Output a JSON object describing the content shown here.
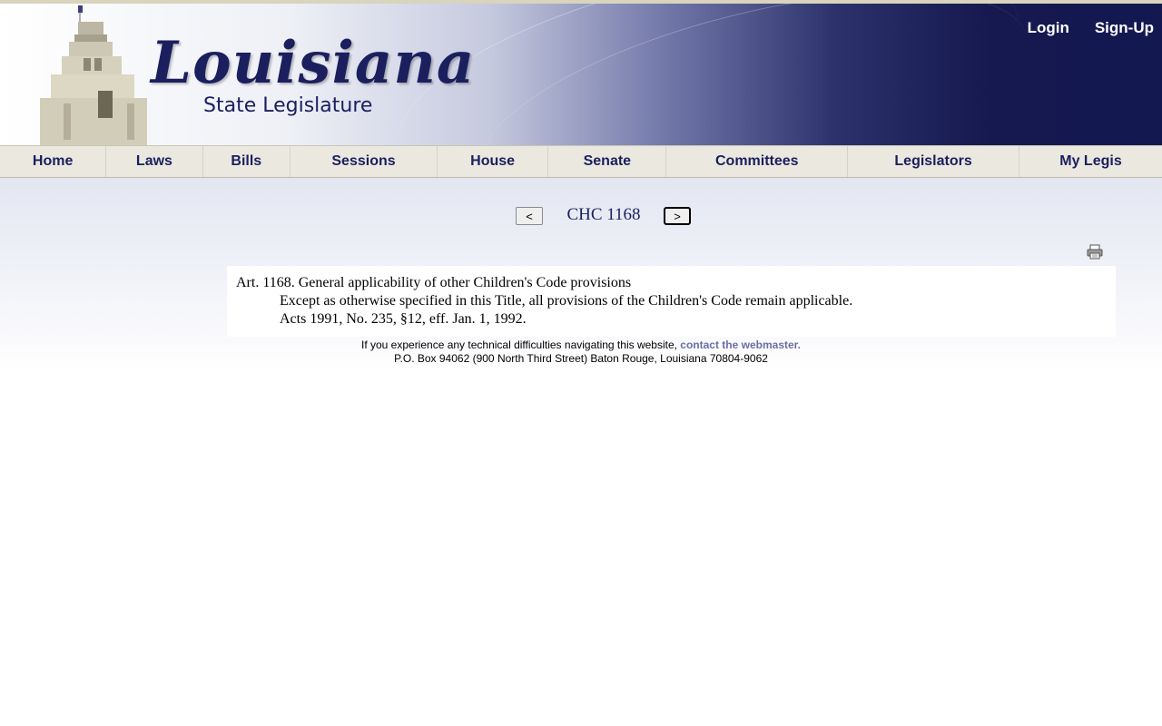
{
  "header": {
    "logo_title": "Louisiana",
    "logo_subtitle": "State Legislature",
    "login_label": "Login",
    "signup_label": "Sign-Up"
  },
  "nav": {
    "items": [
      {
        "label": "Home"
      },
      {
        "label": "Laws"
      },
      {
        "label": "Bills"
      },
      {
        "label": "Sessions"
      },
      {
        "label": "House"
      },
      {
        "label": "Senate"
      },
      {
        "label": "Committees"
      },
      {
        "label": "Legislators"
      },
      {
        "label": "My Legis"
      }
    ]
  },
  "pager": {
    "prev_label": "<",
    "next_label": ">",
    "document_id": "CHC 1168"
  },
  "law": {
    "heading": "Art. 1168.  General applicability of other Children's Code provisions",
    "text": "Except as otherwise specified in this Title, all provisions of the Children's Code remain applicable.",
    "history": "Acts 1991, No. 235, §12, eff. Jan. 1, 1992."
  },
  "footer": {
    "notice": "If you experience any technical difficulties navigating this website, ",
    "contact_link": "contact the webmaster.",
    "address": "P.O. Box 94062 (900 North Third Street) Baton Rouge, Louisiana 70804-9062"
  },
  "icons": {
    "print": "print-icon"
  },
  "colors": {
    "brand_navy": "#1b1f5e",
    "nav_bg": "#eae8df",
    "link_color": "#6a6fa3"
  }
}
